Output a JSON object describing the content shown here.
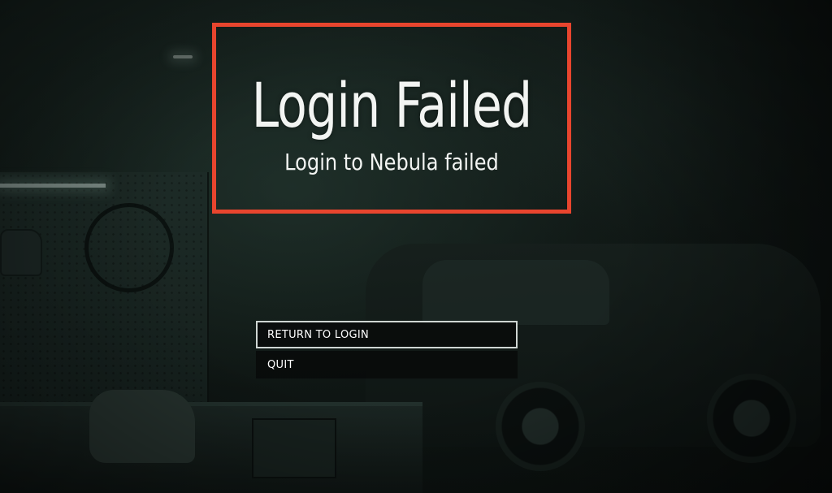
{
  "dialog": {
    "title": "Login Failed",
    "message": "Login to Nebula failed"
  },
  "menu": {
    "items": [
      {
        "label": "RETURN TO LOGIN",
        "selected": true
      },
      {
        "label": "QUIT",
        "selected": false
      }
    ]
  },
  "colors": {
    "highlight_border": "#e8452e",
    "text": "#f2f4f2",
    "button_bg": "#0a0c0c",
    "selected_outline": "#cfd6d3"
  }
}
